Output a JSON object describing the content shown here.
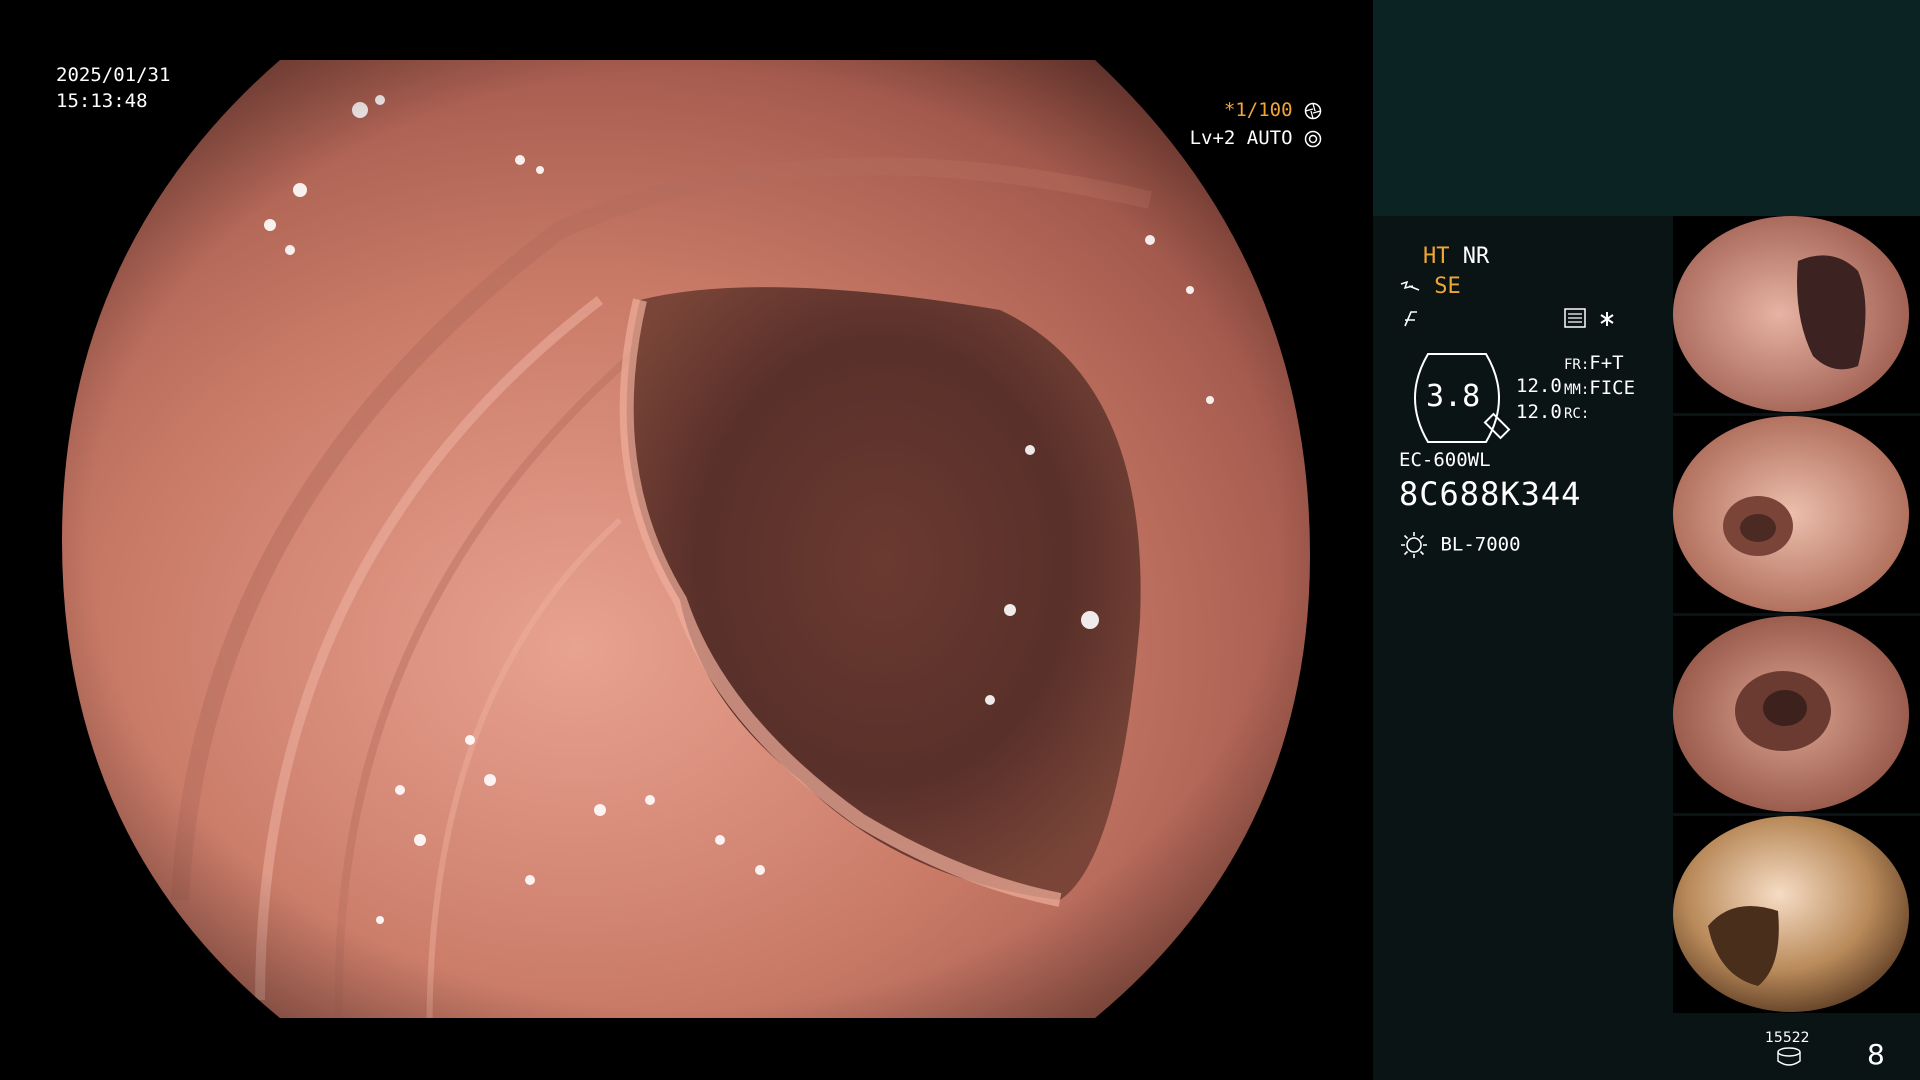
{
  "overlay": {
    "date": "2025/01/31",
    "time": "15:13:48",
    "shutter": "*1/100",
    "light_level": "Lv+2 AUTO"
  },
  "panel": {
    "ht": "HT",
    "nr": "NR",
    "se": "SE",
    "enhancement_value": "3.8",
    "value_top": "12.0",
    "value_bottom": "12.0",
    "fr_label": "FR:",
    "fr_value": "F+T",
    "mm_label": "MM:",
    "mm_value": "FICE",
    "rc_label": "RC:",
    "scope_model": "EC-600WL",
    "scope_serial": "8C688K344",
    "light_source": "BL-7000",
    "storage_count": "15522",
    "image_count": "8"
  },
  "colors": {
    "accent_orange": "#f0a637",
    "panel_bg": "#0b1414",
    "panel_top_bg": "#0c2324"
  },
  "icons": [
    "shutter-icon",
    "auto-iris-icon",
    "structure-icon",
    "edge-icon",
    "menu-icon",
    "asterisk-icon",
    "magnifier-badge-icon",
    "light-source-icon",
    "storage-icon"
  ]
}
